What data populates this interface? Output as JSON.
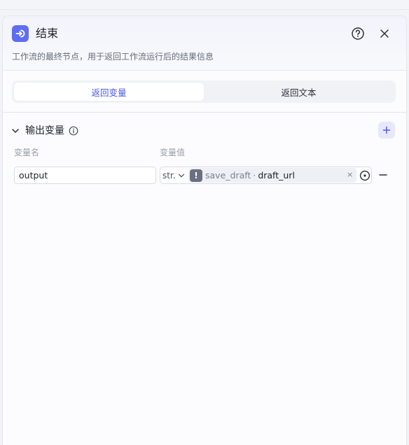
{
  "node": {
    "title": "结束",
    "description": "工作流的最终节点，用于返回工作流运行后的结果信息",
    "icon": "end-node-icon"
  },
  "header_actions": {
    "help_icon": "help-icon",
    "close_icon": "close-icon"
  },
  "tabs": [
    {
      "label": "返回变量",
      "active": true
    },
    {
      "label": "返回文本",
      "active": false
    }
  ],
  "output_section": {
    "title": "输出变量",
    "col_name_label": "变量名",
    "col_value_label": "变量值",
    "variables": [
      {
        "name": "output",
        "type": "str.",
        "ref_node": "save_draft",
        "ref_separator": "·",
        "ref_field": "draft_url",
        "warning_glyph": "!"
      }
    ],
    "clear_glyph": "×"
  },
  "colors": {
    "accent": "#5f6ef0",
    "active_tab_text": "#4a5ae6"
  }
}
